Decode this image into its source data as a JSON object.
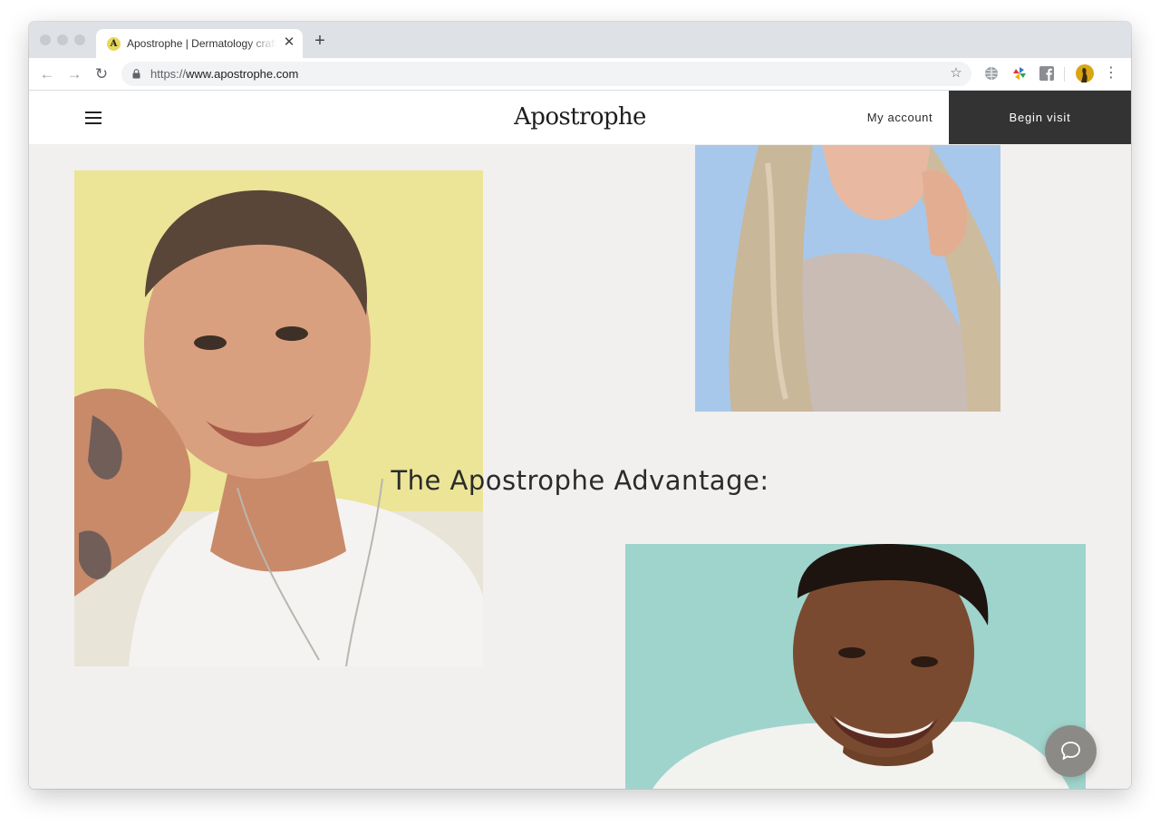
{
  "browser": {
    "tab_title": "Apostrophe | Dermatology crafted",
    "tab_favicon_letter": "A",
    "url_protocol": "https://",
    "url_host": "www.apostrophe.com",
    "tab_close_glyph": "✕",
    "new_tab_glyph": "+",
    "back_glyph": "←",
    "forward_glyph": "→",
    "reload_glyph": "↻",
    "star_glyph": "☆",
    "menu_glyph": "⋮",
    "extensions": [
      "globe-icon",
      "pinwheel-icon",
      "facebook-icon",
      "profile-avatar"
    ]
  },
  "site": {
    "logo": "Apostrophe",
    "my_account": "My account",
    "begin_visit": "Begin visit",
    "headline": "The Apostrophe Advantage:",
    "colors": {
      "page_bg": "#f1f0ef",
      "header_bg": "#ffffff",
      "cta_bg": "#333333",
      "photo_yellow": "#ece497",
      "photo_blue": "#a7c8eb",
      "photo_teal": "#9fd4cc",
      "chat_button": "#8c8a87"
    }
  }
}
